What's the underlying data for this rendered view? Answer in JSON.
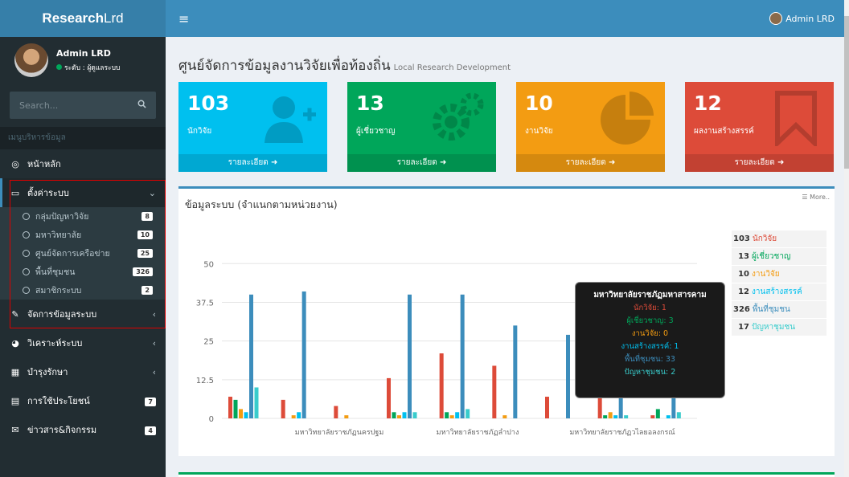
{
  "header": {
    "logo_bold": "Research",
    "logo_rest": "Lrd",
    "menu_icon": "hamburger-icon",
    "user_name": "Admin LRD"
  },
  "sidebar": {
    "user": {
      "name": "Admin LRD",
      "status": "ระดับ : ผู้ดูแลระบบ"
    },
    "search_placeholder": "Search...",
    "menu_header": "เมนูบริหารข้อมูล",
    "home": "หน้าหลัก",
    "settings": "ตั้งค่าระบบ",
    "settings_sub": [
      {
        "label": "กลุ่มปัญหาวิจัย",
        "badge": "8"
      },
      {
        "label": "มหาวิทยาลัย",
        "badge": "10"
      },
      {
        "label": "ศูนย์จัดการเครือข่าย",
        "badge": "25"
      },
      {
        "label": "พื้นที่ชุมชน",
        "badge": "326"
      },
      {
        "label": "สมาชิกระบบ",
        "badge": "2"
      }
    ],
    "manage": "จัดการข้อมูลระบบ",
    "analyze": "วิเคราะห์ระบบ",
    "maintain": "บำรุงรักษา",
    "usage": "การใช้ประโยชน์",
    "usage_badge": "7",
    "news": "ข่าวสาร&กิจกรรม",
    "news_badge": "4"
  },
  "page": {
    "title": "ศูนย์จัดการข้อมูลงานวิจัยเพื่อท้องถิ่น",
    "subtitle": "Local Research Development"
  },
  "stats": [
    {
      "num": "103",
      "label": "นักวิจัย",
      "foot": "รายละเอียด",
      "color": "#00c0ef"
    },
    {
      "num": "13",
      "label": "ผู้เชี่ยวชาญ",
      "foot": "รายละเอียด",
      "color": "#00a65a"
    },
    {
      "num": "10",
      "label": "งานวิจัย",
      "foot": "รายละเอียด",
      "color": "#f39c12"
    },
    {
      "num": "12",
      "label": "ผลงานสร้างสรรค์",
      "foot": "รายละเอียด",
      "color": "#dd4b39"
    }
  ],
  "chart_panel": {
    "title": "ข้อมูลระบบ (จำแนกตามหน่วยงาน)",
    "more": "More.."
  },
  "legend": [
    {
      "num": "103",
      "label": "นักวิจัย",
      "color": "#dd4b39"
    },
    {
      "num": "13",
      "label": "ผู้เชี่ยวชาญ",
      "color": "#00a65a"
    },
    {
      "num": "10",
      "label": "งานวิจัย",
      "color": "#f39c12"
    },
    {
      "num": "12",
      "label": "งานสร้างสรรค์",
      "color": "#00c0ef"
    },
    {
      "num": "326",
      "label": "พื้นที่ชุมชน",
      "color": "#3c8dbc"
    },
    {
      "num": "17",
      "label": "ปัญหาชุมชน",
      "color": "#39cccc"
    }
  ],
  "tooltip": {
    "title": "มหาวิทยาลัยราชภัฏมหาสารคาม",
    "lines": [
      {
        "text": "นักวิจัย: 1",
        "color": "#dd4b39"
      },
      {
        "text": "ผู้เชี่ยวชาญ: 3",
        "color": "#00a65a"
      },
      {
        "text": "งานวิจัย: 0",
        "color": "#f39c12"
      },
      {
        "text": "งานสร้างสรรค์: 1",
        "color": "#00c0ef"
      },
      {
        "text": "พื้นที่ชุมชน: 33",
        "color": "#3c8dbc"
      },
      {
        "text": "ปัญหาชุมชน: 2",
        "color": "#39cccc"
      }
    ]
  },
  "chart_data": {
    "type": "bar",
    "ylim": [
      0,
      55
    ],
    "yticks": [
      "0",
      "12.5",
      "25",
      "37.5",
      "50"
    ],
    "x_labels_shown": [
      "มหาวิทยาลัยราชภัฏนครปฐม",
      "มหาวิทยาลัยราชภัฏลำปาง",
      "มหาวิทยาลัยราชภัฏวไลยอลงกรณ์"
    ],
    "series_colors": [
      "#dd4b39",
      "#00a65a",
      "#f39c12",
      "#00c0ef",
      "#3c8dbc",
      "#39cccc"
    ],
    "groups": [
      [
        7,
        6,
        3,
        2,
        40,
        10
      ],
      [
        6,
        0,
        1,
        2,
        41,
        0
      ],
      [
        4,
        0,
        1,
        0,
        0,
        0
      ],
      [
        13,
        2,
        1,
        2,
        40,
        2
      ],
      [
        21,
        2,
        1,
        2,
        40,
        3
      ],
      [
        17,
        0,
        1,
        0,
        30,
        0
      ],
      [
        7,
        0,
        0,
        0,
        27,
        0
      ],
      [
        18,
        1,
        2,
        1,
        35,
        1
      ],
      [
        1,
        3,
        0,
        1,
        33,
        2
      ]
    ]
  }
}
